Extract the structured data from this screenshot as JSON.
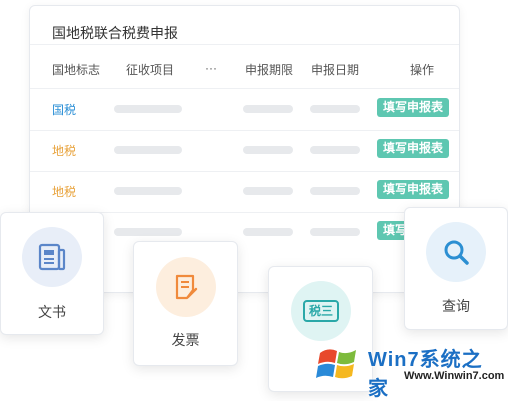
{
  "panel": {
    "title": "国地税联合税费申报",
    "headers": {
      "tax_type": "国地标志",
      "items": "征收项目",
      "more": "···",
      "period": "申报期限",
      "date": "申报日期",
      "action": "操作"
    },
    "rows": [
      {
        "tax_type": "国税",
        "color": "#2b8fd6",
        "action": "填写申报表"
      },
      {
        "tax_type": "地税",
        "color": "#e8a23a",
        "action": "填写申报表"
      },
      {
        "tax_type": "地税",
        "color": "#e8a23a",
        "action": "填写申报表"
      },
      {
        "tax_type": "",
        "color": "#e8a23a",
        "action": "填写申报表"
      }
    ]
  },
  "cards": {
    "documents": {
      "label": "文书",
      "icon": "document-icon",
      "color": "#5b86c9"
    },
    "invoice": {
      "label": "发票",
      "icon": "invoice-icon",
      "color": "#f08a3c"
    },
    "tax": {
      "label": "",
      "icon_text": "税三",
      "icon": "tax-icon",
      "color": "#2aa8a8"
    },
    "query": {
      "label": "查询",
      "icon": "search-icon",
      "color": "#2c8fd2"
    }
  },
  "watermark": {
    "title": "Win7系统之家",
    "url": "Www.Winwin7.com"
  },
  "colors": {
    "accent_green": "#5ec7b1",
    "national_tax_blue": "#2b8fd6",
    "local_tax_orange": "#e8a23a"
  }
}
